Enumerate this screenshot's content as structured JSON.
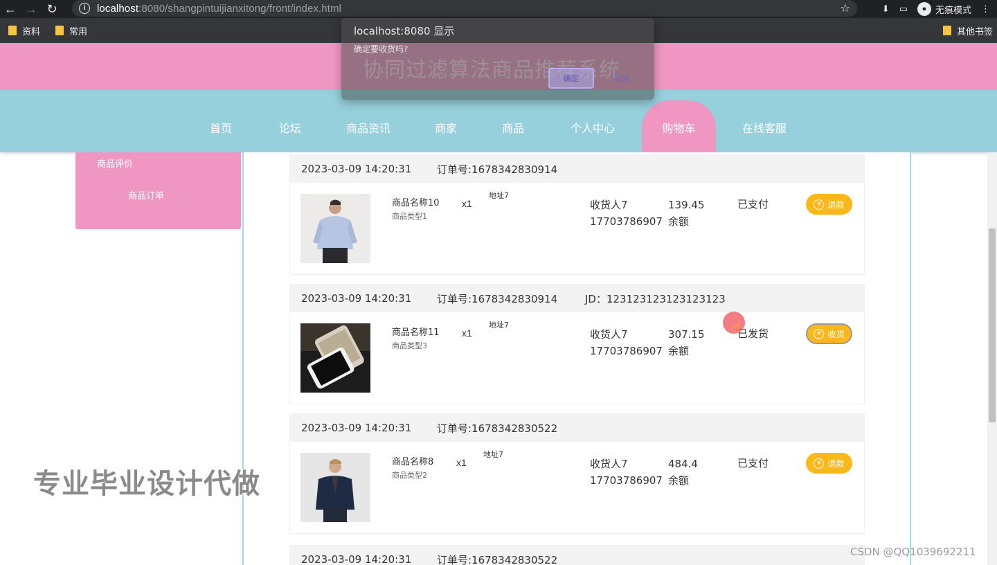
{
  "browser": {
    "url_host": "localhost",
    "url_rest": ":8080/shangpintuijianxitong/front/index.html",
    "incognito_label": "无痕模式",
    "bookmarks": [
      "资料",
      "常用"
    ],
    "other_bookmarks": "其他书签"
  },
  "site": {
    "title": "协同过滤算法商品推荐系统",
    "nav": [
      "首页",
      "论坛",
      "商品资讯",
      "商家",
      "商品",
      "个人中心",
      "购物车",
      "在线客服"
    ],
    "active_nav": "购物车"
  },
  "side_menu": {
    "items": [
      "商品评价",
      "商品订单"
    ]
  },
  "orders": [
    {
      "time": "2023-03-09 14:20:31",
      "order_no": "订单号:1678342830914",
      "jd": "",
      "product_name": "商品名称10",
      "product_type": "商品类型1",
      "qty": "x1",
      "address": "地址7",
      "receiver": "收货人7",
      "phone": "17703786907",
      "price": "139.45",
      "pay_method": "余额",
      "status": "已支付",
      "action": "退款",
      "image": "shirt-man"
    },
    {
      "time": "2023-03-09 14:20:31",
      "order_no": "订单号:1678342830914",
      "jd": "JD：123123123123123123",
      "product_name": "商品名称11",
      "product_type": "商品类型3",
      "qty": "x1",
      "address": "地址7",
      "receiver": "收货人7",
      "phone": "17703786907",
      "price": "307.15",
      "pay_method": "余额",
      "status": "已发货",
      "action": "收货",
      "image": "phones"
    },
    {
      "time": "2023-03-09 14:20:31",
      "order_no": "订单号:1678342830522",
      "jd": "",
      "product_name": "商品名称8",
      "product_type": "商品类型2",
      "qty": "x1",
      "address": "地址7",
      "receiver": "收货人7",
      "phone": "17703786907",
      "price": "484.4",
      "pay_method": "余额",
      "status": "已支付",
      "action": "退款",
      "image": "jacket-man"
    },
    {
      "time": "2023-03-09 14:20:31",
      "order_no": "订单号:1678342830522"
    }
  ],
  "dialog": {
    "title": "localhost:8080 显示",
    "message": "确定要收货吗?",
    "ok": "确定",
    "cancel": "取消"
  },
  "overlay": {
    "watermark": "专业毕业设计代做",
    "csdn": "CSDN @QQ1039692211"
  }
}
